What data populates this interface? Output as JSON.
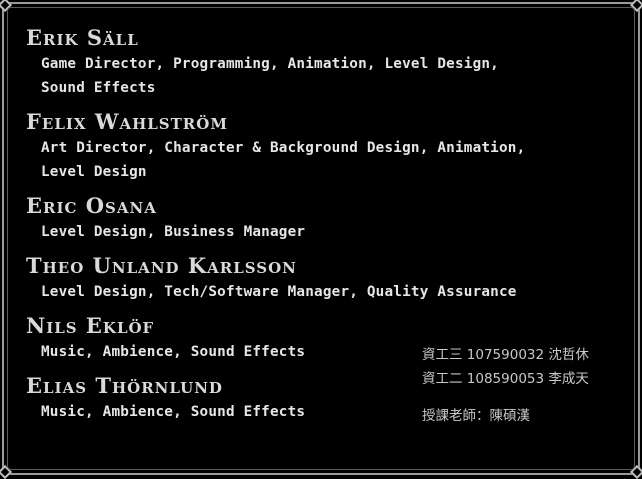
{
  "credits": [
    {
      "name": "Erik Säll",
      "roles": [
        "Game Director, Programming, Animation, Level Design,",
        "Sound Effects"
      ]
    },
    {
      "name": "Felix Wahlström",
      "roles": [
        "Art Director, Character & Background Design, Animation,",
        "Level Design"
      ]
    },
    {
      "name": "Eric Osana",
      "roles": [
        "Level Design, Business Manager"
      ]
    },
    {
      "name": "Theo Unland Karlsson",
      "roles": [
        "Level Design, Tech/Software Manager, Quality Assurance"
      ]
    },
    {
      "name": "Nils Eklöf",
      "roles": [
        "Music, Ambience, Sound Effects"
      ]
    },
    {
      "name": "Elias Thörnlund",
      "roles": [
        "Music, Ambience, Sound Effects"
      ]
    }
  ],
  "students": [
    "資工三 107590032 沈哲休",
    "資工二 108590053 李成天"
  ],
  "teacher": "授課老師：陳碩漢"
}
